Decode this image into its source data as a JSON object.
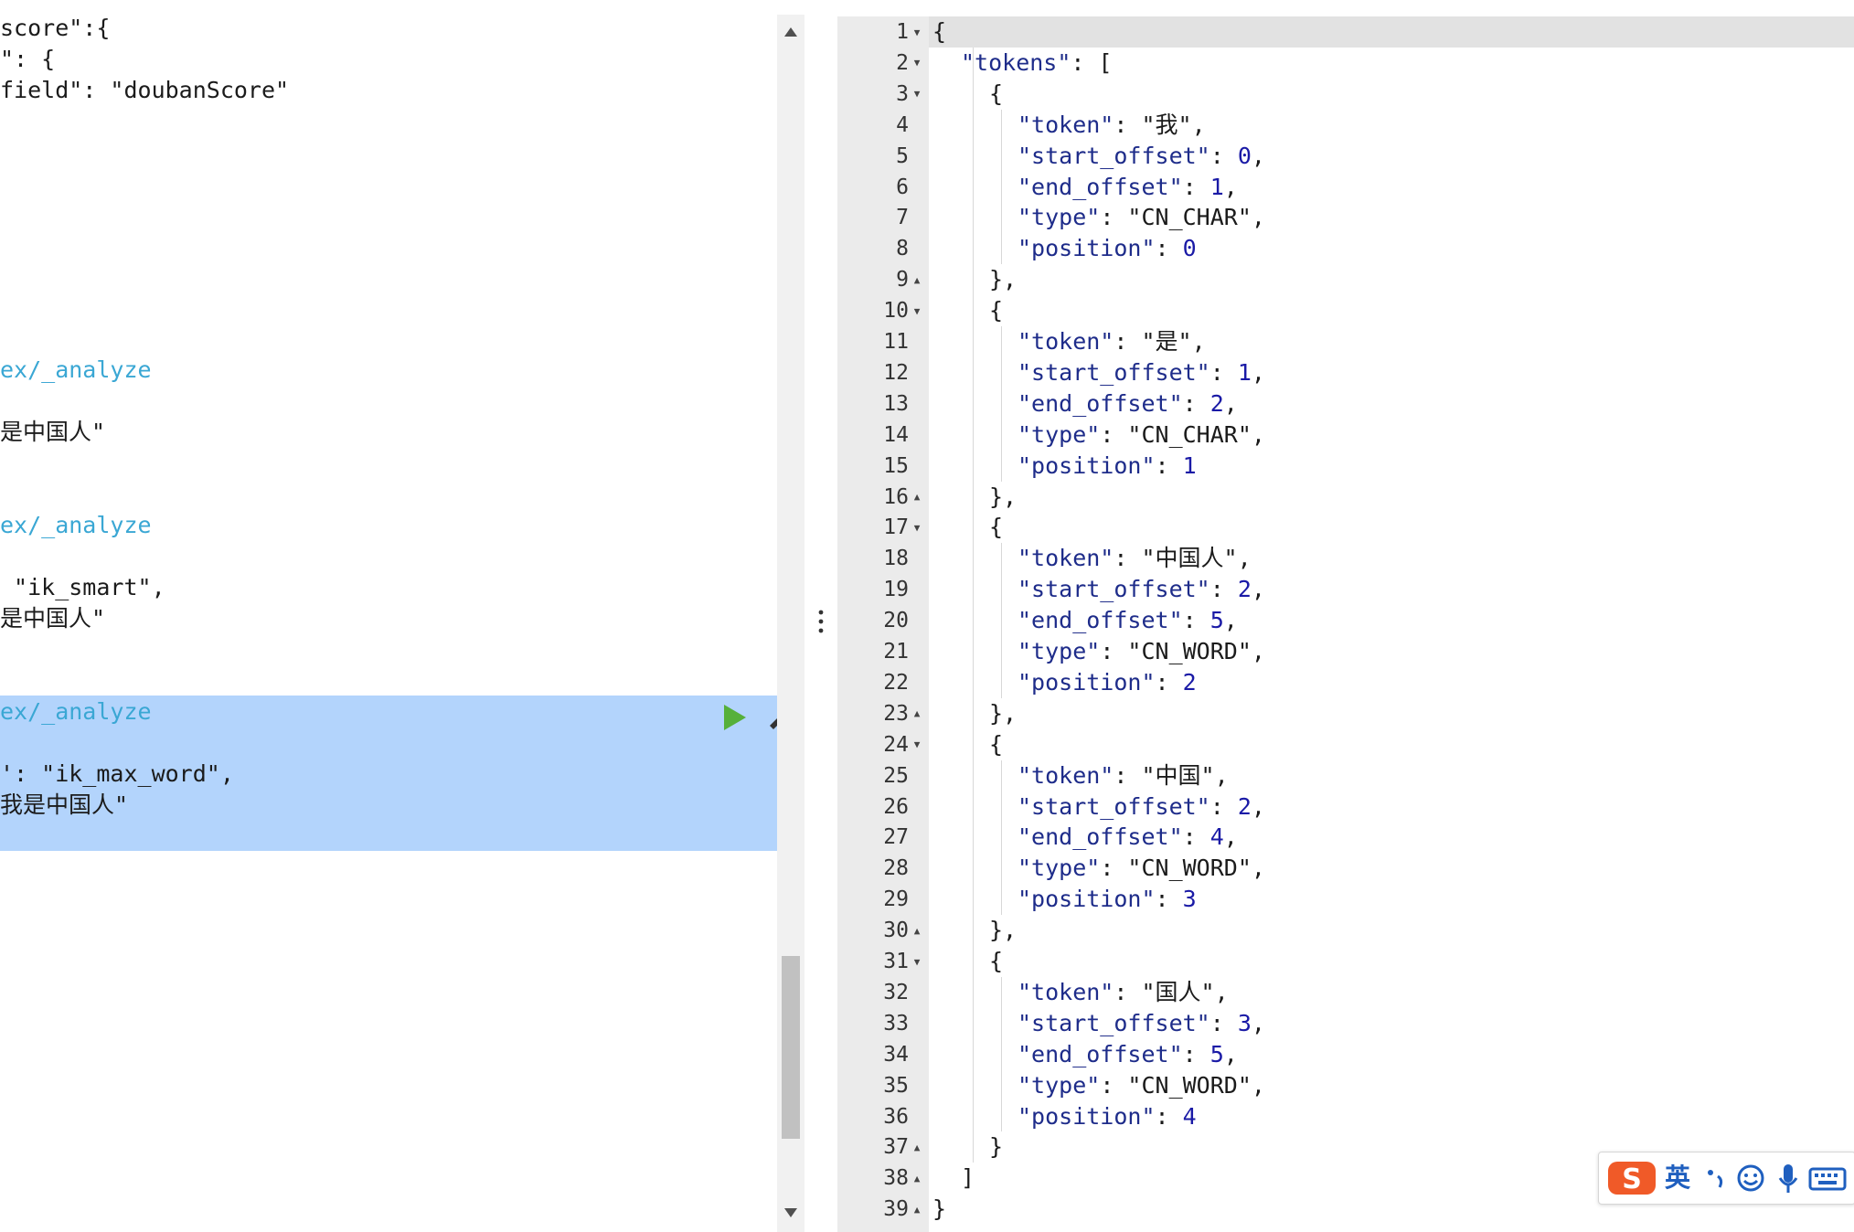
{
  "request_editor": {
    "lines": [
      {
        "row": 0,
        "parts": [
          {
            "t": "score\":{",
            "c": "tok-str"
          }
        ]
      },
      {
        "row": 1,
        "parts": [
          {
            "t": "\": {",
            "c": "tok-str"
          }
        ]
      },
      {
        "row": 2,
        "parts": [
          {
            "t": "field\": \"doubanScore\"",
            "c": "tok-str"
          }
        ]
      },
      {
        "row": 11,
        "parts": [
          {
            "t": "ex/_analyze",
            "c": "tok-url"
          }
        ]
      },
      {
        "row": 13,
        "parts": [
          {
            "t": "是中国人\"",
            "c": "tok-str"
          }
        ]
      },
      {
        "row": 16,
        "parts": [
          {
            "t": "ex/_analyze",
            "c": "tok-url"
          }
        ]
      },
      {
        "row": 18,
        "parts": [
          {
            "t": " \"ik_smart\",",
            "c": "tok-str"
          }
        ]
      },
      {
        "row": 19,
        "parts": [
          {
            "t": "是中国人\"",
            "c": "tok-str"
          }
        ]
      },
      {
        "row": 22,
        "parts": [
          {
            "t": "ex/_analyze",
            "c": "tok-url"
          }
        ]
      },
      {
        "row": 24,
        "parts": [
          {
            "t": "': \"ik_max_word\",",
            "c": "tok-str"
          }
        ]
      },
      {
        "row": 25,
        "parts": [
          {
            "t": "我是中国人\"",
            "c": "tok-str"
          }
        ]
      }
    ],
    "run_icon": "play-icon",
    "settings_icon": "wrench-icon"
  },
  "scrollbar": {
    "up_icon": "arrow-up-icon",
    "down_icon": "arrow-down-icon"
  },
  "splitter": {
    "icon": "vertical-dots-icon"
  },
  "response_viewer": {
    "lines": [
      {
        "n": "1",
        "fold": "down",
        "indent": 0,
        "parts": [
          [
            "{",
            "j-punc"
          ]
        ]
      },
      {
        "n": "2",
        "fold": "down",
        "indent": 1,
        "parts": [
          [
            "\"tokens\"",
            "j-key"
          ],
          [
            ": [",
            "j-punc"
          ]
        ]
      },
      {
        "n": "3",
        "fold": "down",
        "indent": 2,
        "parts": [
          [
            "{",
            "j-punc"
          ]
        ]
      },
      {
        "n": "4",
        "fold": "",
        "indent": 3,
        "parts": [
          [
            "\"token\"",
            "j-key"
          ],
          [
            ": ",
            "j-punc"
          ],
          [
            "\"我\"",
            "j-str"
          ],
          [
            ",",
            "j-punc"
          ]
        ]
      },
      {
        "n": "5",
        "fold": "",
        "indent": 3,
        "parts": [
          [
            "\"start_offset\"",
            "j-key"
          ],
          [
            ": ",
            "j-punc"
          ],
          [
            "0",
            "j-num"
          ],
          [
            ",",
            "j-punc"
          ]
        ]
      },
      {
        "n": "6",
        "fold": "",
        "indent": 3,
        "parts": [
          [
            "\"end_offset\"",
            "j-key"
          ],
          [
            ": ",
            "j-punc"
          ],
          [
            "1",
            "j-num"
          ],
          [
            ",",
            "j-punc"
          ]
        ]
      },
      {
        "n": "7",
        "fold": "",
        "indent": 3,
        "parts": [
          [
            "\"type\"",
            "j-key"
          ],
          [
            ": ",
            "j-punc"
          ],
          [
            "\"CN_CHAR\"",
            "j-str"
          ],
          [
            ",",
            "j-punc"
          ]
        ]
      },
      {
        "n": "8",
        "fold": "",
        "indent": 3,
        "parts": [
          [
            "\"position\"",
            "j-key"
          ],
          [
            ": ",
            "j-punc"
          ],
          [
            "0",
            "j-num"
          ]
        ]
      },
      {
        "n": "9",
        "fold": "up",
        "indent": 2,
        "parts": [
          [
            "},",
            "j-punc"
          ]
        ]
      },
      {
        "n": "10",
        "fold": "down",
        "indent": 2,
        "parts": [
          [
            "{",
            "j-punc"
          ]
        ]
      },
      {
        "n": "11",
        "fold": "",
        "indent": 3,
        "parts": [
          [
            "\"token\"",
            "j-key"
          ],
          [
            ": ",
            "j-punc"
          ],
          [
            "\"是\"",
            "j-str"
          ],
          [
            ",",
            "j-punc"
          ]
        ]
      },
      {
        "n": "12",
        "fold": "",
        "indent": 3,
        "parts": [
          [
            "\"start_offset\"",
            "j-key"
          ],
          [
            ": ",
            "j-punc"
          ],
          [
            "1",
            "j-num"
          ],
          [
            ",",
            "j-punc"
          ]
        ]
      },
      {
        "n": "13",
        "fold": "",
        "indent": 3,
        "parts": [
          [
            "\"end_offset\"",
            "j-key"
          ],
          [
            ": ",
            "j-punc"
          ],
          [
            "2",
            "j-num"
          ],
          [
            ",",
            "j-punc"
          ]
        ]
      },
      {
        "n": "14",
        "fold": "",
        "indent": 3,
        "parts": [
          [
            "\"type\"",
            "j-key"
          ],
          [
            ": ",
            "j-punc"
          ],
          [
            "\"CN_CHAR\"",
            "j-str"
          ],
          [
            ",",
            "j-punc"
          ]
        ]
      },
      {
        "n": "15",
        "fold": "",
        "indent": 3,
        "parts": [
          [
            "\"position\"",
            "j-key"
          ],
          [
            ": ",
            "j-punc"
          ],
          [
            "1",
            "j-num"
          ]
        ]
      },
      {
        "n": "16",
        "fold": "up",
        "indent": 2,
        "parts": [
          [
            "},",
            "j-punc"
          ]
        ]
      },
      {
        "n": "17",
        "fold": "down",
        "indent": 2,
        "parts": [
          [
            "{",
            "j-punc"
          ]
        ]
      },
      {
        "n": "18",
        "fold": "",
        "indent": 3,
        "parts": [
          [
            "\"token\"",
            "j-key"
          ],
          [
            ": ",
            "j-punc"
          ],
          [
            "\"中国人\"",
            "j-str"
          ],
          [
            ",",
            "j-punc"
          ]
        ]
      },
      {
        "n": "19",
        "fold": "",
        "indent": 3,
        "parts": [
          [
            "\"start_offset\"",
            "j-key"
          ],
          [
            ": ",
            "j-punc"
          ],
          [
            "2",
            "j-num"
          ],
          [
            ",",
            "j-punc"
          ]
        ]
      },
      {
        "n": "20",
        "fold": "",
        "indent": 3,
        "parts": [
          [
            "\"end_offset\"",
            "j-key"
          ],
          [
            ": ",
            "j-punc"
          ],
          [
            "5",
            "j-num"
          ],
          [
            ",",
            "j-punc"
          ]
        ]
      },
      {
        "n": "21",
        "fold": "",
        "indent": 3,
        "parts": [
          [
            "\"type\"",
            "j-key"
          ],
          [
            ": ",
            "j-punc"
          ],
          [
            "\"CN_WORD\"",
            "j-str"
          ],
          [
            ",",
            "j-punc"
          ]
        ]
      },
      {
        "n": "22",
        "fold": "",
        "indent": 3,
        "parts": [
          [
            "\"position\"",
            "j-key"
          ],
          [
            ": ",
            "j-punc"
          ],
          [
            "2",
            "j-num"
          ]
        ]
      },
      {
        "n": "23",
        "fold": "up",
        "indent": 2,
        "parts": [
          [
            "},",
            "j-punc"
          ]
        ]
      },
      {
        "n": "24",
        "fold": "down",
        "indent": 2,
        "parts": [
          [
            "{",
            "j-punc"
          ]
        ]
      },
      {
        "n": "25",
        "fold": "",
        "indent": 3,
        "parts": [
          [
            "\"token\"",
            "j-key"
          ],
          [
            ": ",
            "j-punc"
          ],
          [
            "\"中国\"",
            "j-str"
          ],
          [
            ",",
            "j-punc"
          ]
        ]
      },
      {
        "n": "26",
        "fold": "",
        "indent": 3,
        "parts": [
          [
            "\"start_offset\"",
            "j-key"
          ],
          [
            ": ",
            "j-punc"
          ],
          [
            "2",
            "j-num"
          ],
          [
            ",",
            "j-punc"
          ]
        ]
      },
      {
        "n": "27",
        "fold": "",
        "indent": 3,
        "parts": [
          [
            "\"end_offset\"",
            "j-key"
          ],
          [
            ": ",
            "j-punc"
          ],
          [
            "4",
            "j-num"
          ],
          [
            ",",
            "j-punc"
          ]
        ]
      },
      {
        "n": "28",
        "fold": "",
        "indent": 3,
        "parts": [
          [
            "\"type\"",
            "j-key"
          ],
          [
            ": ",
            "j-punc"
          ],
          [
            "\"CN_WORD\"",
            "j-str"
          ],
          [
            ",",
            "j-punc"
          ]
        ]
      },
      {
        "n": "29",
        "fold": "",
        "indent": 3,
        "parts": [
          [
            "\"position\"",
            "j-key"
          ],
          [
            ": ",
            "j-punc"
          ],
          [
            "3",
            "j-num"
          ]
        ]
      },
      {
        "n": "30",
        "fold": "up",
        "indent": 2,
        "parts": [
          [
            "},",
            "j-punc"
          ]
        ]
      },
      {
        "n": "31",
        "fold": "down",
        "indent": 2,
        "parts": [
          [
            "{",
            "j-punc"
          ]
        ]
      },
      {
        "n": "32",
        "fold": "",
        "indent": 3,
        "parts": [
          [
            "\"token\"",
            "j-key"
          ],
          [
            ": ",
            "j-punc"
          ],
          [
            "\"国人\"",
            "j-str"
          ],
          [
            ",",
            "j-punc"
          ]
        ]
      },
      {
        "n": "33",
        "fold": "",
        "indent": 3,
        "parts": [
          [
            "\"start_offset\"",
            "j-key"
          ],
          [
            ": ",
            "j-punc"
          ],
          [
            "3",
            "j-num"
          ],
          [
            ",",
            "j-punc"
          ]
        ]
      },
      {
        "n": "34",
        "fold": "",
        "indent": 3,
        "parts": [
          [
            "\"end_offset\"",
            "j-key"
          ],
          [
            ": ",
            "j-punc"
          ],
          [
            "5",
            "j-num"
          ],
          [
            ",",
            "j-punc"
          ]
        ]
      },
      {
        "n": "35",
        "fold": "",
        "indent": 3,
        "parts": [
          [
            "\"type\"",
            "j-key"
          ],
          [
            ": ",
            "j-punc"
          ],
          [
            "\"CN_WORD\"",
            "j-str"
          ],
          [
            ",",
            "j-punc"
          ]
        ]
      },
      {
        "n": "36",
        "fold": "",
        "indent": 3,
        "parts": [
          [
            "\"position\"",
            "j-key"
          ],
          [
            ": ",
            "j-punc"
          ],
          [
            "4",
            "j-num"
          ]
        ]
      },
      {
        "n": "37",
        "fold": "up",
        "indent": 2,
        "parts": [
          [
            "}",
            "j-punc"
          ]
        ]
      },
      {
        "n": "38",
        "fold": "up",
        "indent": 1,
        "parts": [
          [
            "]",
            "j-punc"
          ]
        ]
      },
      {
        "n": "39",
        "fold": "up",
        "indent": 0,
        "parts": [
          [
            "}",
            "j-punc"
          ]
        ]
      }
    ]
  },
  "ime_toolbar": {
    "logo_icon": "sogou-logo-icon",
    "lang_label": "英",
    "items": [
      "punctuation-icon",
      "emoji-icon",
      "microphone-icon",
      "keyboard-icon"
    ],
    "colors": {
      "logo": "#f05a28",
      "icons": "#1f5fbf"
    }
  }
}
